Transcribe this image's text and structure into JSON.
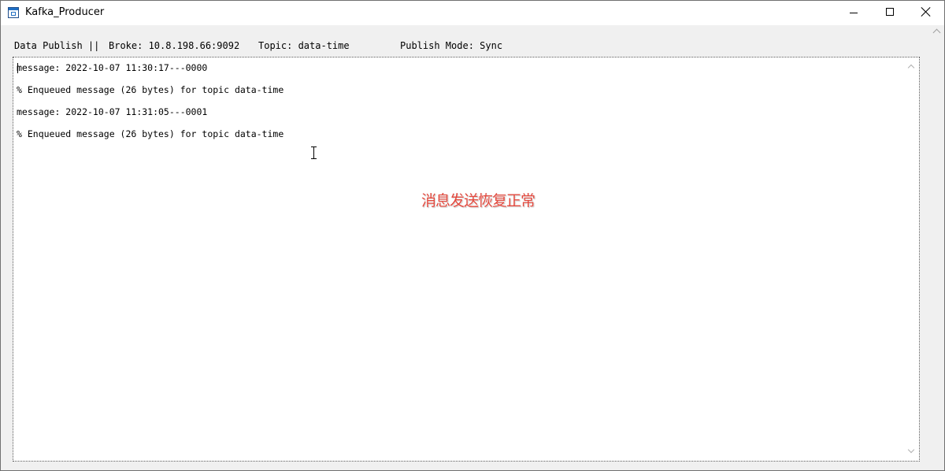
{
  "window": {
    "title": "Kafka_Producer"
  },
  "status": {
    "publish": "Data Publish ||",
    "broke": "Broke: 10.8.198.66:9092",
    "topic": "Topic: data-time",
    "mode": "Publish Mode: Sync"
  },
  "log": {
    "lines": [
      "message: 2022-10-07 11:30:17---0000",
      "% Enqueued message (26 bytes) for topic data-time",
      "message: 2022-10-07 11:31:05---0001",
      "% Enqueued message (26 bytes) for topic data-time"
    ]
  },
  "annotation": {
    "text": "消息发送恢复正常",
    "color": "#e2483d"
  },
  "icons": {
    "app": "app-window-icon",
    "minimize": "minimize-icon",
    "maximize": "maximize-icon",
    "close": "close-icon",
    "cursor": "text-cursor-icon"
  }
}
